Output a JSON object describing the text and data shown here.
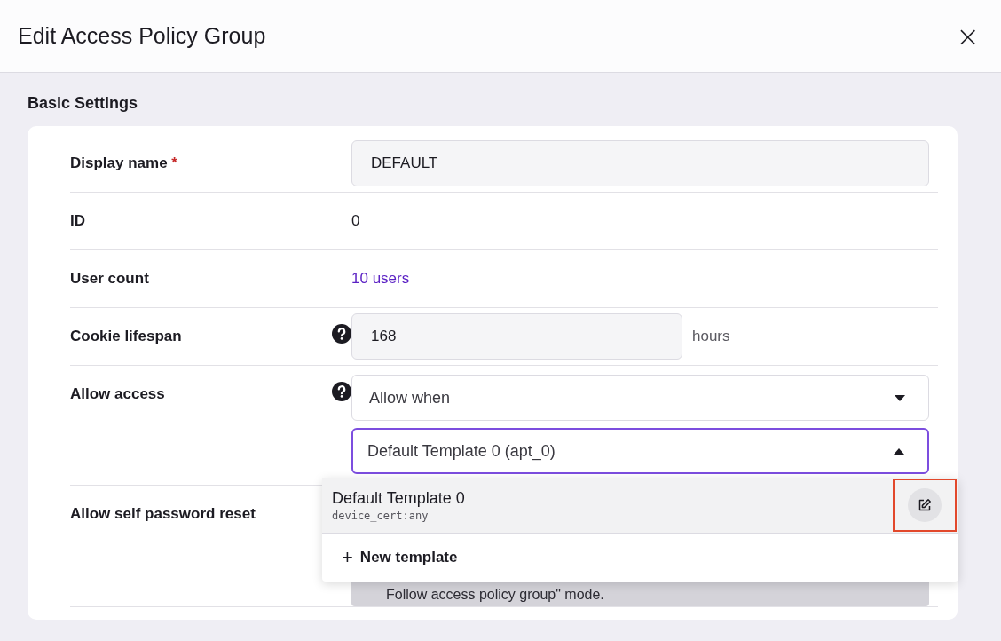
{
  "dialog": {
    "title": "Edit Access Policy Group",
    "close": "×"
  },
  "section": {
    "title": "Basic Settings"
  },
  "rows": [
    {
      "kind": "input",
      "label": "Display name",
      "required_mark": "*",
      "help": false,
      "value": "DEFAULT"
    },
    {
      "kind": "text",
      "label": "ID",
      "help": false,
      "value": "0"
    },
    {
      "kind": "link",
      "label": "User count",
      "help": false,
      "value": "10 users"
    },
    {
      "kind": "unit",
      "label": "Cookie lifespan",
      "help": true,
      "value": "168",
      "unit": "hours"
    },
    {
      "kind": "selects",
      "label": "Allow access",
      "help": true,
      "mode": {
        "value": "Allow when",
        "expanded": false
      },
      "template": {
        "value": "Default Template 0 (apt_0)",
        "expanded": true
      }
    },
    {
      "kind": "note",
      "label": "Allow self password reset",
      "help": false,
      "note": "Follow access policy group\" mode."
    }
  ],
  "dropdown": {
    "options": [
      {
        "name": "Default Template 0",
        "detail": "device_cert:any",
        "selected": true,
        "highlighted": true
      }
    ],
    "add": {
      "icon": "+",
      "label": "New template"
    }
  }
}
